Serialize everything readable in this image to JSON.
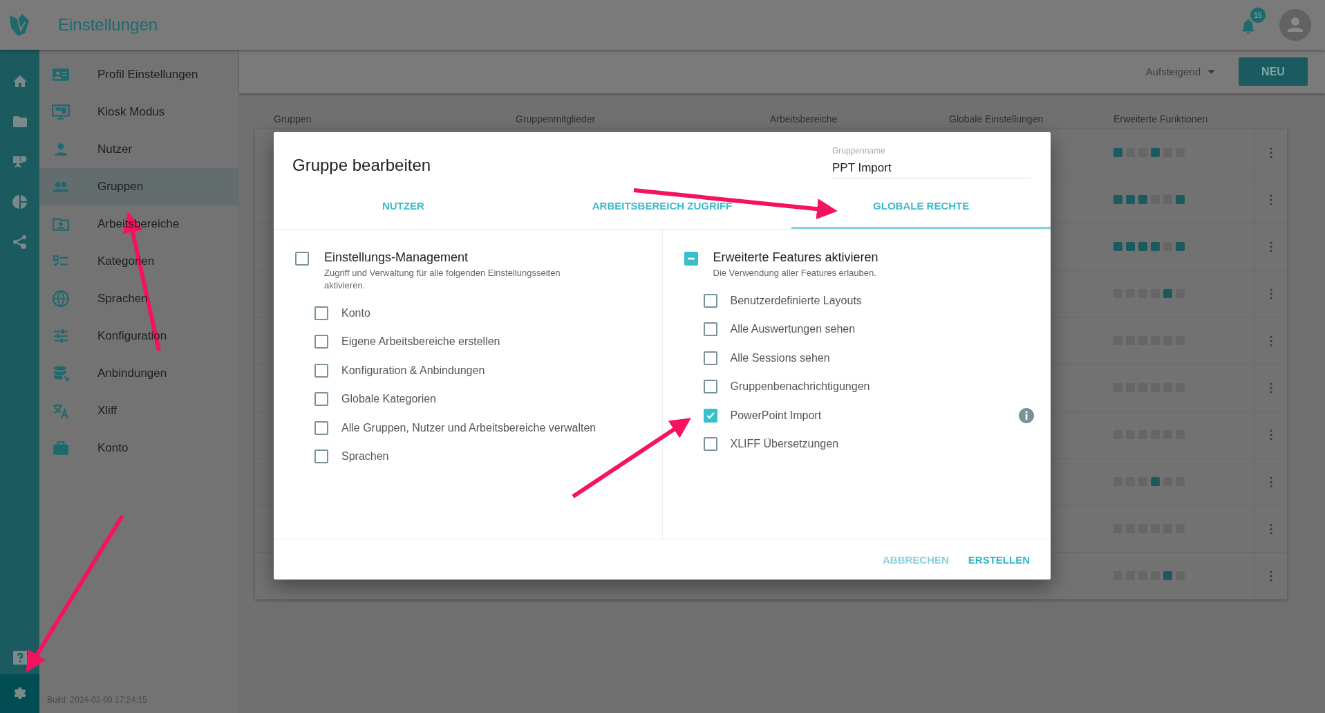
{
  "header": {
    "title": "Einstellungen",
    "notifications": "15"
  },
  "sidebar": {
    "items": [
      {
        "label": "Profil Einstellungen",
        "selected": false
      },
      {
        "label": "Kiosk Modus",
        "selected": false
      },
      {
        "label": "Nutzer",
        "selected": false
      },
      {
        "label": "Gruppen",
        "selected": true
      },
      {
        "label": "Arbeitsbereiche",
        "selected": false
      },
      {
        "label": "Kategorien",
        "selected": false
      },
      {
        "label": "Sprachen",
        "selected": false
      },
      {
        "label": "Konfiguration",
        "selected": false
      },
      {
        "label": "Anbindungen",
        "selected": false
      },
      {
        "label": "Xliff",
        "selected": false
      },
      {
        "label": "Konto",
        "selected": false
      }
    ],
    "build": "Build: 2024-02-09 17:24:15"
  },
  "toolbar": {
    "sort": "Aufsteigend",
    "new_button": "NEU"
  },
  "table": {
    "columns": [
      "Gruppen",
      "Gruppenmitglieder",
      "Arbeitsbereiche",
      "Globale Einstellungen",
      "Erweiterte Funktionen"
    ],
    "rows": [
      {
        "features": [
          true,
          false,
          false,
          true,
          false,
          false
        ]
      },
      {
        "features": [
          true,
          true,
          true,
          false,
          false,
          true
        ]
      },
      {
        "features": [
          true,
          true,
          true,
          true,
          false,
          true
        ]
      },
      {
        "features": [
          false,
          false,
          false,
          false,
          true,
          false
        ]
      },
      {
        "features": [
          false,
          false,
          false,
          false,
          false,
          false
        ]
      },
      {
        "features": [
          false,
          false,
          false,
          false,
          false,
          false
        ]
      },
      {
        "features": [
          false,
          false,
          false,
          false,
          false,
          false
        ]
      },
      {
        "features": [
          false,
          false,
          false,
          true,
          false,
          false
        ]
      },
      {
        "features": [
          false,
          false,
          false,
          false,
          false,
          false
        ]
      },
      {
        "features": [
          false,
          false,
          false,
          false,
          true,
          false
        ]
      }
    ]
  },
  "dialog": {
    "title": "Gruppe bearbeiten",
    "name_field": {
      "label": "Gruppenname",
      "value": "PPT Import"
    },
    "tabs": [
      {
        "label": "NUTZER",
        "selected": false
      },
      {
        "label": "ARBEITSBEREICH ZUGRIFF",
        "selected": false
      },
      {
        "label": "GLOBALE RECHTE",
        "selected": true
      }
    ],
    "sections": [
      {
        "title": "Einstellungs-Management",
        "description": "Zugriff und Verwaltung für alle folgenden Einstellungsseiten aktivieren.",
        "checked": false,
        "indeterminate": false,
        "items": [
          {
            "label": "Konto",
            "checked": false
          },
          {
            "label": "Eigene Arbeitsbereiche erstellen",
            "checked": false
          },
          {
            "label": "Konfiguration & Anbindungen",
            "checked": false
          },
          {
            "label": "Globale Kategorien",
            "checked": false
          },
          {
            "label": "Alle Gruppen, Nutzer und Arbeitsbereiche verwalten",
            "checked": false
          },
          {
            "label": "Sprachen",
            "checked": false
          }
        ]
      },
      {
        "title": "Erweiterte Features aktivieren",
        "description": "Die Verwendung aller Features erlauben.",
        "indeterminate": true,
        "items": [
          {
            "label": "Benutzerdefinierte Layouts",
            "checked": false
          },
          {
            "label": "Alle Auswertungen sehen",
            "checked": false
          },
          {
            "label": "Alle Sessions sehen",
            "checked": false
          },
          {
            "label": "Gruppenbenachrichtigungen",
            "checked": false
          },
          {
            "label": "PowerPoint Import",
            "checked": true,
            "info": true
          },
          {
            "label": "XLIFF Übersetzungen",
            "checked": false
          }
        ]
      }
    ],
    "buttons": [
      {
        "label": "ABBRECHEN",
        "kind": "secondary"
      },
      {
        "label": "ERSTELLEN",
        "kind": "primary"
      }
    ]
  }
}
